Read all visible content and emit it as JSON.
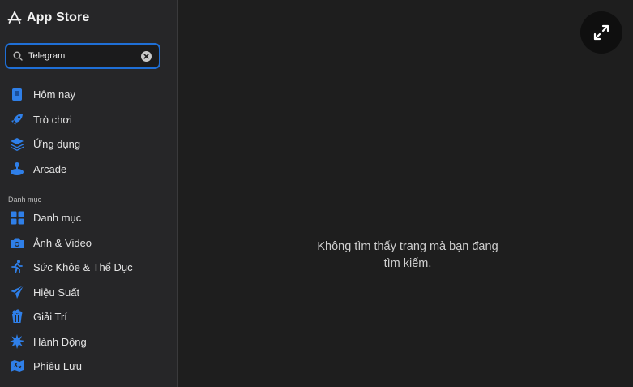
{
  "app": {
    "title": "App Store"
  },
  "search": {
    "value": "Telegram"
  },
  "nav": {
    "items": [
      {
        "label": "Hôm nay",
        "icon": "today-icon"
      },
      {
        "label": "Trò chơi",
        "icon": "rocket-icon"
      },
      {
        "label": "Ứng dụng",
        "icon": "layers-icon"
      },
      {
        "label": "Arcade",
        "icon": "joystick-icon"
      }
    ]
  },
  "categories": {
    "section_label": "Danh mục",
    "items": [
      {
        "label": "Danh mục",
        "icon": "grid-icon"
      },
      {
        "label": "Ảnh & Video",
        "icon": "camera-icon"
      },
      {
        "label": "Sức Khỏe & Thể Dục",
        "icon": "running-icon"
      },
      {
        "label": "Hiệu Suất",
        "icon": "paper-plane-icon"
      },
      {
        "label": "Giải Trí",
        "icon": "popcorn-icon"
      },
      {
        "label": "Hành Động",
        "icon": "burst-icon"
      },
      {
        "label": "Phiêu Lưu",
        "icon": "map-icon"
      }
    ]
  },
  "main": {
    "message_line1": "Không tìm thấy trang mà bạn đang",
    "message_line2": "tìm kiếm."
  },
  "colors": {
    "accent": "#2f7fe8",
    "focus_ring": "#1f6fd6",
    "background": "#1e1e1e",
    "sidebar": "#262628"
  }
}
